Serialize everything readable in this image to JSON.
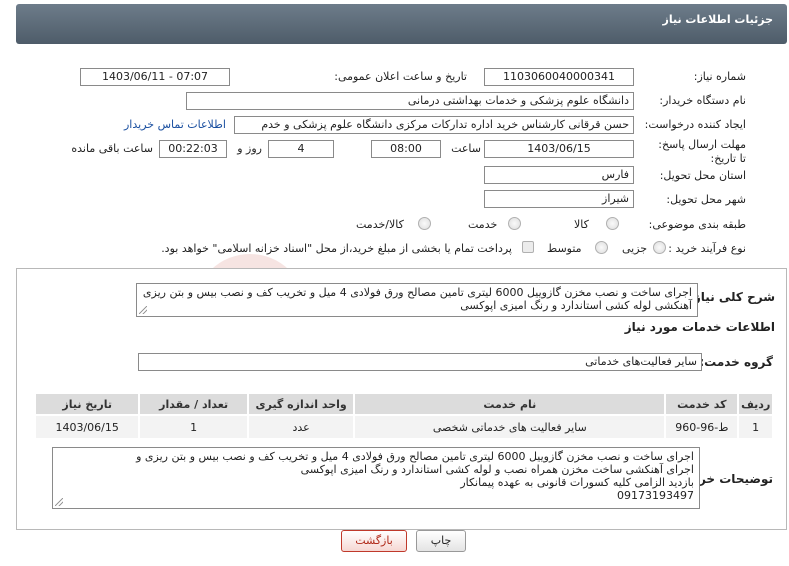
{
  "header": {
    "title": "جزئیات اطلاعات نیاز"
  },
  "form": {
    "need_number_label": "شماره نیاز:",
    "need_number": "1103060040000341",
    "announce_label": "تاریخ و ساعت اعلان عمومی:",
    "announce_value": "1403/06/11 - 07:07",
    "buyer_org_label": "نام دستگاه خریدار:",
    "buyer_org": "دانشگاه علوم پزشکی و خدمات بهداشتی درمانی",
    "creator_label": "ایجاد کننده درخواست:",
    "creator": "حسن قرقانی کارشناس خرید اداره تدارکات مرکزی دانشگاه علوم پزشکی و خدم",
    "contact_link": "اطلاعات تماس خریدار",
    "deadline_label": "مهلت ارسال پاسخ: تا تاریخ:",
    "deadline_date": "1403/06/15",
    "time_label": "ساعت",
    "deadline_time": "08:00",
    "days_value": "4",
    "days_label": "روز و",
    "remaining_time": "00:22:03",
    "remaining_label": "ساعت باقی مانده",
    "province_label": "استان محل تحویل:",
    "province": "فارس",
    "city_label": "شهر محل تحویل:",
    "city": "شیراز",
    "category_label": "طبقه بندی موضوعی:",
    "category_options": [
      "کالا",
      "خدمت",
      "کالا/خدمت"
    ],
    "process_label": "نوع فرآیند خرید :",
    "process_options": [
      "جزیی",
      "متوسط"
    ],
    "payment_note": "پرداخت تمام یا بخشی از مبلغ خرید،از محل \"اسناد خزانه اسلامی\" خواهد بود."
  },
  "summary": {
    "label": "شرح کلی نیاز:",
    "text": "اجرای ساخت و نصب مخزن گازوییل 6000 لیتری تامین مصالح ورق فولادی 4 میل و تخریب کف و نصب بیس و بتن ریزی آهنکشی لوله کشی استاندارد و رنگ امیزی اپوکسی"
  },
  "services": {
    "section_title": "اطلاعات خدمات مورد نیاز",
    "group_label": "گروه خدمت:",
    "group_value": "سایر فعالیت‌های خدماتی",
    "columns": [
      "ردیف",
      "کد خدمت",
      "نام خدمت",
      "واحد اندازه گیری",
      "تعداد / مقدار",
      "تاریخ نیاز"
    ],
    "rows": [
      [
        "1",
        "ط-96-960",
        "سایر فعالیت های خدماتی شخصی",
        "عدد",
        "1",
        "1403/06/15"
      ]
    ]
  },
  "buyer_notes": {
    "label": "توضیحات خریدار:",
    "lines": [
      "اجرای ساخت و نصب مخزن گازوییل 6000 لیتری تامین مصالح ورق فولادی 4 میل و تخریب کف و نصب بیس و بتن ریزی و",
      "اجرای آهنکشی ساخت مخزن همراه نصب و لوله کشی استاندارد و رنگ امیزی اپوکسی",
      "بازدید الزامی کلیه کسورات قانونی به عهده پیمانکار",
      "09173193497"
    ]
  },
  "buttons": {
    "print": "چاپ",
    "back": "بازگشت"
  },
  "colors": {
    "header": "#5b6a78",
    "link": "#1a4fa0",
    "back_button": "#c0392b"
  }
}
